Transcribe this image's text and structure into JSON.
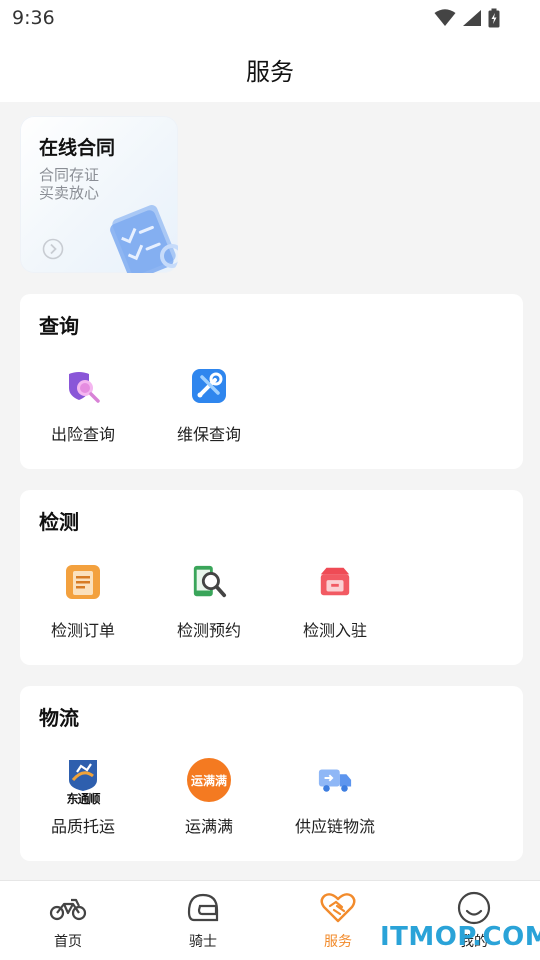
{
  "status_bar": {
    "time": "9:36"
  },
  "header": {
    "title": "服务"
  },
  "contract_card": {
    "title": "在线合同",
    "line1": "合同存证",
    "line2": "买卖放心"
  },
  "sections": [
    {
      "title": "查询",
      "items": [
        {
          "label": "出险查询",
          "icon": "search-shield-icon"
        },
        {
          "label": "维保查询",
          "icon": "wrench-icon"
        }
      ]
    },
    {
      "title": "检测",
      "items": [
        {
          "label": "检测订单",
          "icon": "order-doc-icon"
        },
        {
          "label": "检测预约",
          "icon": "phone-search-icon"
        },
        {
          "label": "检测入驻",
          "icon": "store-icon"
        }
      ]
    },
    {
      "title": "物流",
      "items": [
        {
          "label": "品质托运",
          "icon": "brand-logo-icon",
          "logo_text": "东通顺"
        },
        {
          "label": "运满满",
          "icon": "yunmanman-logo-icon",
          "logo_text": "运满满"
        },
        {
          "label": "供应链物流",
          "icon": "truck-icon"
        }
      ]
    }
  ],
  "bottom_nav": [
    {
      "label": "首页",
      "icon": "motorcycle-icon"
    },
    {
      "label": "骑士",
      "icon": "helmet-icon"
    },
    {
      "label": "服务",
      "icon": "heart-handshake-icon",
      "active": true
    },
    {
      "label": "我的",
      "icon": "smile-icon"
    }
  ],
  "watermark": "ITMOP.COM",
  "colors": {
    "accent": "#f28b2c",
    "background": "#f4f4f4",
    "watermark": "#2aa3d8"
  }
}
